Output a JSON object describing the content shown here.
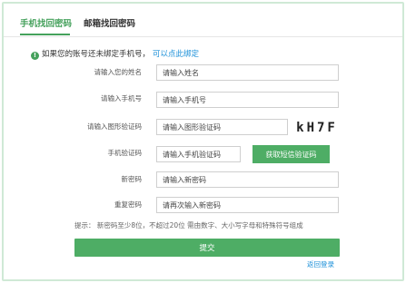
{
  "tabs": {
    "phone": "手机找回密码",
    "email": "邮箱找回密码"
  },
  "notice": {
    "text": "如果您的账号还未绑定手机号，",
    "link": "可以点此绑定"
  },
  "form": {
    "name_label": "请输入您的姓名",
    "name_placeholder": "请输入姓名",
    "phone_label": "请输入手机号",
    "phone_placeholder": "请输入手机号",
    "captcha_label": "请输入图形验证码",
    "captcha_placeholder": "请输入图形验证码",
    "captcha_text": "kH7F",
    "sms_label": "手机验证码",
    "sms_placeholder": "请输入手机验证码",
    "sms_button": "获取短信验证码",
    "new_pwd_label": "新密码",
    "new_pwd_placeholder": "请输入新密码",
    "confirm_pwd_label": "重复密码",
    "confirm_pwd_placeholder": "请再次输入新密码"
  },
  "hint": "提示：  新密码至少8位，不超过20位 需由数字、大小写字母和特殊符号组成",
  "submit": "提交",
  "back_login": "返回登录",
  "colors": {
    "accent": "#4ead65",
    "link": "#1a8fd8",
    "border": "#cfe9d6"
  }
}
